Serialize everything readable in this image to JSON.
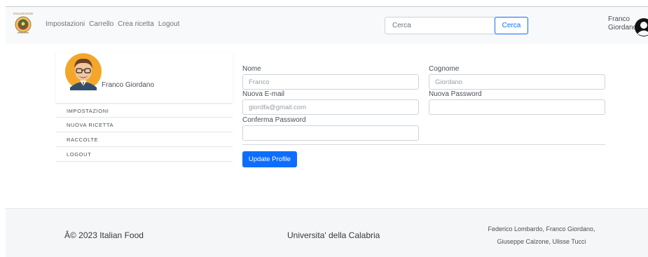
{
  "navbar": {
    "logo_text": "ITALIAN FOOD",
    "links": [
      "Impostazioni",
      "Carrello",
      "Crea ricetta",
      "Logout"
    ],
    "search": {
      "placeholder": "Cerca",
      "button_label": "Cerca"
    },
    "user": {
      "first_name": "Franco",
      "last_name": "Giordano"
    }
  },
  "sidebar": {
    "profile_name": "Franco Giordano",
    "items": [
      "IMPOSTAZIONI",
      "NUOVA RICETTA",
      "RACCOLTE",
      "LOGOUT"
    ]
  },
  "form": {
    "nome": {
      "label": "Nome",
      "placeholder": "Franco"
    },
    "cognome": {
      "label": "Cognome",
      "placeholder": "Giordano"
    },
    "email": {
      "label": "Nuova E-mail",
      "placeholder": "giordfa@gmail.com"
    },
    "password": {
      "label": "Nuova Password",
      "placeholder": ""
    },
    "confirm": {
      "label": "Conferma Password",
      "placeholder": ""
    },
    "submit_label": "Update Profile"
  },
  "footer": {
    "copyright": "Â© 2023 Italian Food",
    "university": "Universita' della Calabria",
    "authors_line1": "Federico Lombardo, Franco Giordano,",
    "authors_line2": "Giuseppe Calzone, Ulisse Tucci"
  },
  "colors": {
    "primary": "#0d6efd",
    "navbar_bg": "#f8f9fa",
    "footer_bg": "#f5f6f7",
    "text_muted": "#6c757d"
  },
  "icons": [
    "italian-food-logo",
    "user-account-icon",
    "chef-avatar"
  ]
}
